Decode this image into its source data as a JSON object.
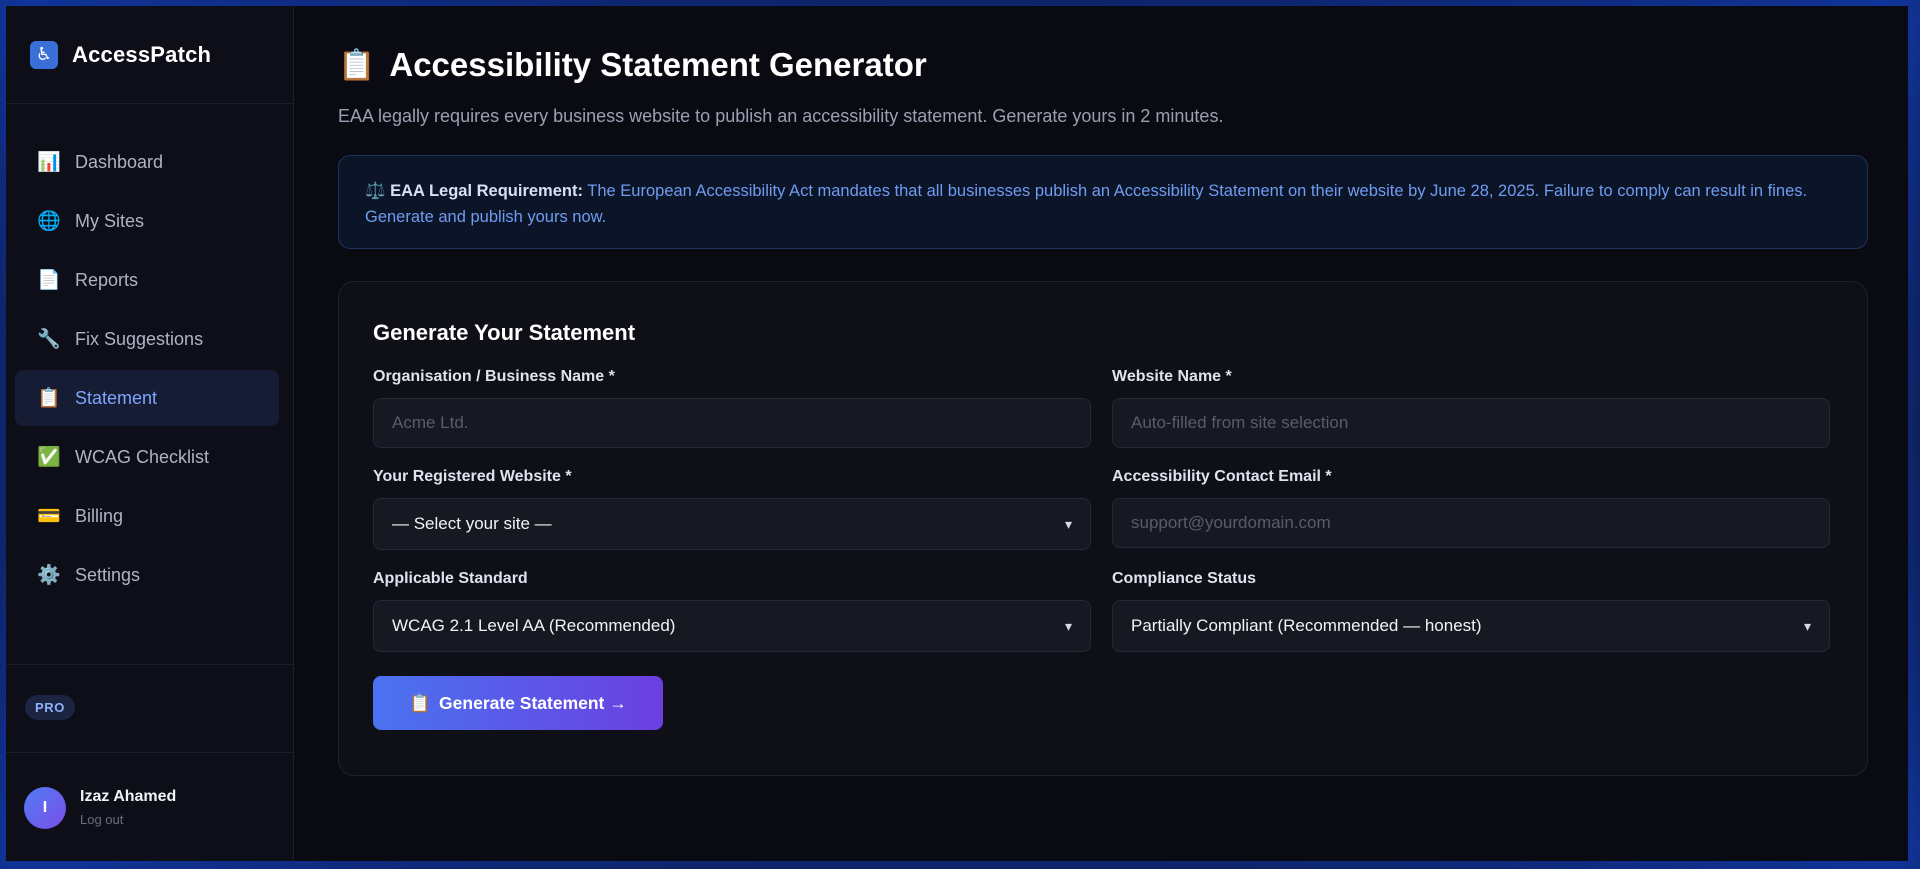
{
  "brand": {
    "name": "AccessPatch",
    "icon": "wheelchair-icon"
  },
  "nav": {
    "items": [
      {
        "label": "Dashboard",
        "icon": "📊"
      },
      {
        "label": "My Sites",
        "icon": "🌐"
      },
      {
        "label": "Reports",
        "icon": "📄"
      },
      {
        "label": "Fix Suggestions",
        "icon": "🔧"
      },
      {
        "label": "Statement",
        "icon": "📋"
      },
      {
        "label": "WCAG Checklist",
        "icon": "✅"
      },
      {
        "label": "Billing",
        "icon": "💳"
      },
      {
        "label": "Settings",
        "icon": "⚙️"
      }
    ],
    "active_index": 4
  },
  "plan": {
    "badge": "PRO"
  },
  "user": {
    "initial": "I",
    "name": "Izaz Ahamed",
    "logout_label": "Log out"
  },
  "page": {
    "title_icon": "📋",
    "title": "Accessibility Statement Generator",
    "subtitle": "EAA legally requires every business website to publish an accessibility statement. Generate yours in 2 minutes."
  },
  "notice": {
    "icon": "⚖️",
    "label": "EAA Legal Requirement:",
    "text": "The European Accessibility Act mandates that all businesses publish an Accessibility Statement on their website by June 28, 2025. Failure to comply can result in fines. Generate and publish yours now."
  },
  "form": {
    "title": "Generate Your Statement",
    "org_label": "Organisation / Business Name *",
    "org_placeholder": "Acme Ltd.",
    "website_name_label": "Website Name *",
    "website_name_placeholder": "Auto-filled from site selection",
    "site_label": "Your Registered Website *",
    "site_value": "— Select your site —",
    "email_label": "Accessibility Contact Email *",
    "email_placeholder": "support@yourdomain.com",
    "standard_label": "Applicable Standard",
    "standard_value": "WCAG 2.1 Level AA (Recommended)",
    "status_label": "Compliance Status",
    "status_value": "Partially Compliant (Recommended — honest)",
    "button_icon": "📋",
    "button_label": "Generate Statement →"
  },
  "colors": {
    "accent": "#7ea6ff",
    "button_start": "#4a73f0",
    "button_end": "#6b3fe0",
    "background": "#0a0b12"
  }
}
